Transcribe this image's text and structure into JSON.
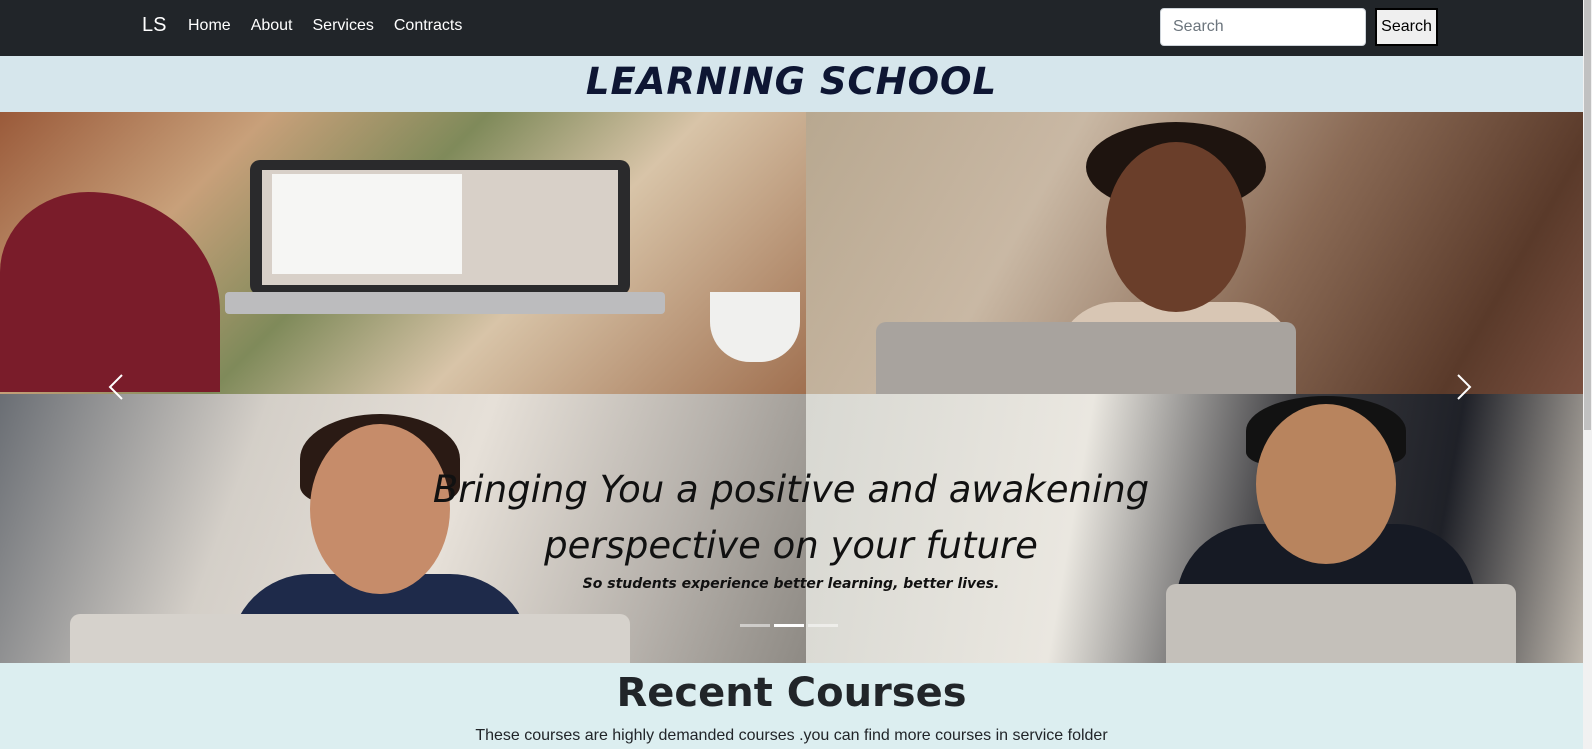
{
  "navbar": {
    "brand": "LS",
    "links": [
      "Home",
      "About",
      "Services",
      "Contracts"
    ],
    "search_placeholder": "Search",
    "search_button": "Search"
  },
  "header": {
    "title": "LEARNING SCHOOL"
  },
  "carousel": {
    "headline": "Bringing You a positive and awakening perspective on your future",
    "subtext": "So students experience better learning, better lives.",
    "slide_count": 3,
    "active_slide_index": 1
  },
  "courses": {
    "title": "Recent Courses",
    "description": "These courses are highly demanded courses .you can find more courses in service folder"
  },
  "colors": {
    "navbar_bg": "#212529",
    "header_bg": "#d6e6ec",
    "page_bg": "#dceef0",
    "title_color": "#0e1633"
  }
}
